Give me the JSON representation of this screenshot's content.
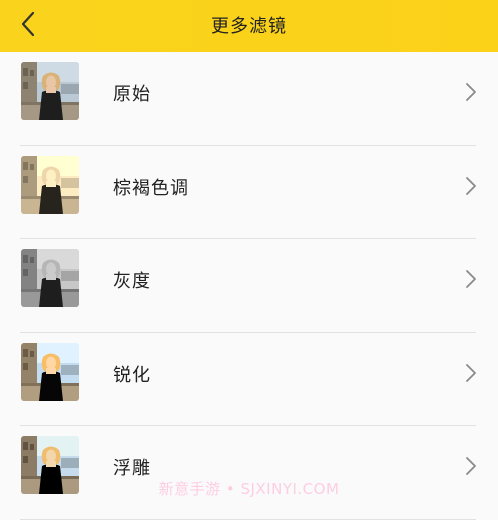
{
  "header": {
    "title": "更多滤镜",
    "back_icon": "chevron-left-icon",
    "background": "#fcd219"
  },
  "filters": [
    {
      "label": "原始",
      "tint": "original"
    },
    {
      "label": "棕褐色调",
      "tint": "sepia"
    },
    {
      "label": "灰度",
      "tint": "grayscale"
    },
    {
      "label": "锐化",
      "tint": "sharpen"
    },
    {
      "label": "浮雕",
      "tint": "emboss"
    }
  ],
  "list_chevron_icon": "chevron-right-icon",
  "watermark": "新意手游 • SJXINYI.COM"
}
